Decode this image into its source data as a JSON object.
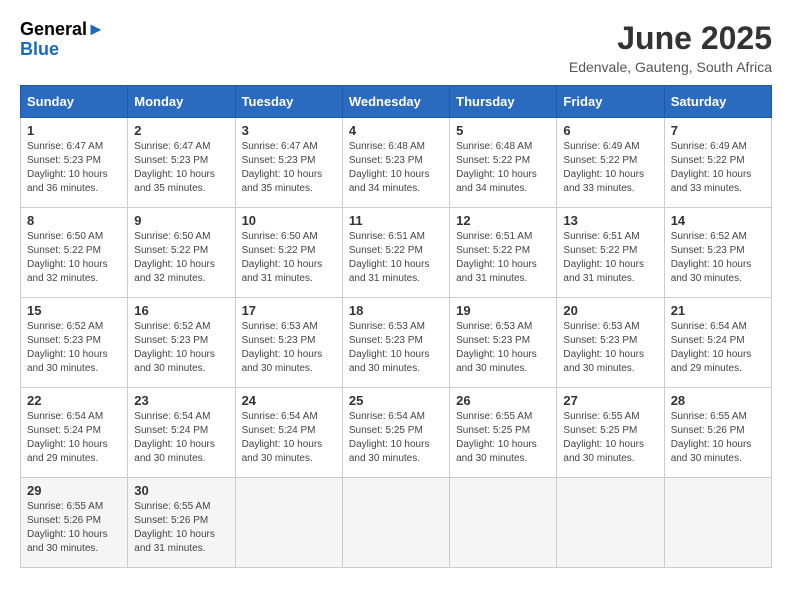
{
  "header": {
    "logo_general": "General",
    "logo_blue": "Blue",
    "month_title": "June 2025",
    "location": "Edenvale, Gauteng, South Africa"
  },
  "weekdays": [
    "Sunday",
    "Monday",
    "Tuesday",
    "Wednesday",
    "Thursday",
    "Friday",
    "Saturday"
  ],
  "weeks": [
    [
      {
        "day": "1",
        "sunrise": "6:47 AM",
        "sunset": "5:23 PM",
        "daylight": "10 hours and 36 minutes."
      },
      {
        "day": "2",
        "sunrise": "6:47 AM",
        "sunset": "5:23 PM",
        "daylight": "10 hours and 35 minutes."
      },
      {
        "day": "3",
        "sunrise": "6:47 AM",
        "sunset": "5:23 PM",
        "daylight": "10 hours and 35 minutes."
      },
      {
        "day": "4",
        "sunrise": "6:48 AM",
        "sunset": "5:23 PM",
        "daylight": "10 hours and 34 minutes."
      },
      {
        "day": "5",
        "sunrise": "6:48 AM",
        "sunset": "5:22 PM",
        "daylight": "10 hours and 34 minutes."
      },
      {
        "day": "6",
        "sunrise": "6:49 AM",
        "sunset": "5:22 PM",
        "daylight": "10 hours and 33 minutes."
      },
      {
        "day": "7",
        "sunrise": "6:49 AM",
        "sunset": "5:22 PM",
        "daylight": "10 hours and 33 minutes."
      }
    ],
    [
      {
        "day": "8",
        "sunrise": "6:50 AM",
        "sunset": "5:22 PM",
        "daylight": "10 hours and 32 minutes."
      },
      {
        "day": "9",
        "sunrise": "6:50 AM",
        "sunset": "5:22 PM",
        "daylight": "10 hours and 32 minutes."
      },
      {
        "day": "10",
        "sunrise": "6:50 AM",
        "sunset": "5:22 PM",
        "daylight": "10 hours and 31 minutes."
      },
      {
        "day": "11",
        "sunrise": "6:51 AM",
        "sunset": "5:22 PM",
        "daylight": "10 hours and 31 minutes."
      },
      {
        "day": "12",
        "sunrise": "6:51 AM",
        "sunset": "5:22 PM",
        "daylight": "10 hours and 31 minutes."
      },
      {
        "day": "13",
        "sunrise": "6:51 AM",
        "sunset": "5:22 PM",
        "daylight": "10 hours and 31 minutes."
      },
      {
        "day": "14",
        "sunrise": "6:52 AM",
        "sunset": "5:23 PM",
        "daylight": "10 hours and 30 minutes."
      }
    ],
    [
      {
        "day": "15",
        "sunrise": "6:52 AM",
        "sunset": "5:23 PM",
        "daylight": "10 hours and 30 minutes."
      },
      {
        "day": "16",
        "sunrise": "6:52 AM",
        "sunset": "5:23 PM",
        "daylight": "10 hours and 30 minutes."
      },
      {
        "day": "17",
        "sunrise": "6:53 AM",
        "sunset": "5:23 PM",
        "daylight": "10 hours and 30 minutes."
      },
      {
        "day": "18",
        "sunrise": "6:53 AM",
        "sunset": "5:23 PM",
        "daylight": "10 hours and 30 minutes."
      },
      {
        "day": "19",
        "sunrise": "6:53 AM",
        "sunset": "5:23 PM",
        "daylight": "10 hours and 30 minutes."
      },
      {
        "day": "20",
        "sunrise": "6:53 AM",
        "sunset": "5:23 PM",
        "daylight": "10 hours and 30 minutes."
      },
      {
        "day": "21",
        "sunrise": "6:54 AM",
        "sunset": "5:24 PM",
        "daylight": "10 hours and 29 minutes."
      }
    ],
    [
      {
        "day": "22",
        "sunrise": "6:54 AM",
        "sunset": "5:24 PM",
        "daylight": "10 hours and 29 minutes."
      },
      {
        "day": "23",
        "sunrise": "6:54 AM",
        "sunset": "5:24 PM",
        "daylight": "10 hours and 30 minutes."
      },
      {
        "day": "24",
        "sunrise": "6:54 AM",
        "sunset": "5:24 PM",
        "daylight": "10 hours and 30 minutes."
      },
      {
        "day": "25",
        "sunrise": "6:54 AM",
        "sunset": "5:25 PM",
        "daylight": "10 hours and 30 minutes."
      },
      {
        "day": "26",
        "sunrise": "6:55 AM",
        "sunset": "5:25 PM",
        "daylight": "10 hours and 30 minutes."
      },
      {
        "day": "27",
        "sunrise": "6:55 AM",
        "sunset": "5:25 PM",
        "daylight": "10 hours and 30 minutes."
      },
      {
        "day": "28",
        "sunrise": "6:55 AM",
        "sunset": "5:26 PM",
        "daylight": "10 hours and 30 minutes."
      }
    ],
    [
      {
        "day": "29",
        "sunrise": "6:55 AM",
        "sunset": "5:26 PM",
        "daylight": "10 hours and 30 minutes."
      },
      {
        "day": "30",
        "sunrise": "6:55 AM",
        "sunset": "5:26 PM",
        "daylight": "10 hours and 31 minutes."
      },
      {
        "day": "",
        "sunrise": "",
        "sunset": "",
        "daylight": ""
      },
      {
        "day": "",
        "sunrise": "",
        "sunset": "",
        "daylight": ""
      },
      {
        "day": "",
        "sunrise": "",
        "sunset": "",
        "daylight": ""
      },
      {
        "day": "",
        "sunrise": "",
        "sunset": "",
        "daylight": ""
      },
      {
        "day": "",
        "sunrise": "",
        "sunset": "",
        "daylight": ""
      }
    ]
  ]
}
